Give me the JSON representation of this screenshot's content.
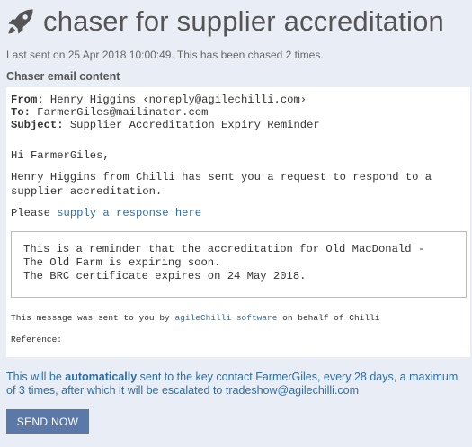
{
  "header": {
    "icon": "rocket-icon",
    "title": "chaser for supplier accreditation"
  },
  "meta": {
    "last_sent": "Last sent on 25 Apr 2018 10:00:49. This has been chased 2 times."
  },
  "section": {
    "heading": "Chaser email content"
  },
  "email": {
    "from_label": "From:",
    "from_value": " Henry Higgins ‹noreply@agilechilli.com›",
    "to_label": "To:",
    "to_value": " FarmerGiles@mailinator.com",
    "subject_label": "Subject:",
    "subject_value": " Supplier Accreditation Expiry Reminder",
    "greeting": "Hi FarmerGiles,",
    "body_line": "Henry Higgins from Chilli has sent you a request to respond to a supplier accreditation.",
    "please_prefix": "Please ",
    "please_link": "supply a response here",
    "reminder_line1": "This is a reminder that the accreditation for Old MacDonald -",
    "reminder_line2": "The Old Farm is expiring soon.",
    "reminder_line3": "The BRC certificate expires on 24 May 2018.",
    "footer_prefix": "This message was sent to you by ",
    "footer_link": "agileChilli software",
    "footer_suffix": " on behalf of Chilli",
    "reference_label": "Reference:"
  },
  "auto_note": {
    "prefix": "This will be ",
    "emphasis": "automatically",
    "suffix": " sent to the key contact FarmerGiles, every 28 days, a maximum of 3 times, after which it will be escalated to tradeshow@agilechilli.com"
  },
  "actions": {
    "send_now": "SEND NOW"
  },
  "colors": {
    "background": "#e9edf5",
    "link": "#2e6da4",
    "button": "#5b79a8"
  }
}
